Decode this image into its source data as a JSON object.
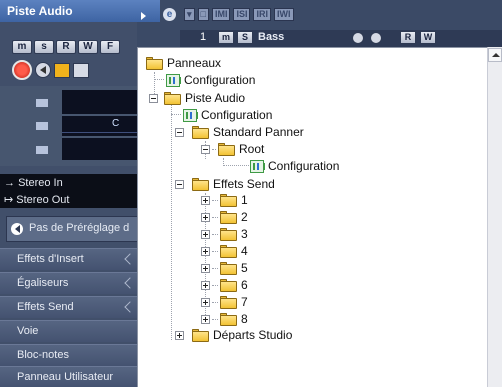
{
  "inspector": {
    "title": "Piste Audio",
    "buttons": [
      "m",
      "s",
      "R",
      "W",
      "F"
    ],
    "fader_values": [
      "",
      "C",
      ""
    ],
    "routing_in": "Stereo In",
    "routing_out": "Stereo Out",
    "preset": "Pas de Préréglage d",
    "sections": [
      "Effets d'Insert",
      "Égaliseurs",
      "Effets Send",
      "Voie",
      "Bloc-notes",
      "Panneau Utilisateur"
    ]
  },
  "track": {
    "number": "1",
    "name": "Bass",
    "m": "m",
    "s": "S",
    "r": "R",
    "w": "W",
    "top_icons": [
      "IMI",
      "ISI",
      "IRI",
      "IWI"
    ]
  },
  "tree": {
    "root": "Panneaux",
    "configuration": "Configuration",
    "piste_audio": "Piste Audio",
    "standard_panner": "Standard Panner",
    "root_node": "Root",
    "effets_send": "Effets Send",
    "sends": [
      "1",
      "2",
      "3",
      "4",
      "5",
      "6",
      "7",
      "8"
    ],
    "departs_studio": "Départs Studio"
  },
  "colors": {
    "accent": "#3e64a3",
    "folder": "#f2c234",
    "record": "#e03020"
  }
}
